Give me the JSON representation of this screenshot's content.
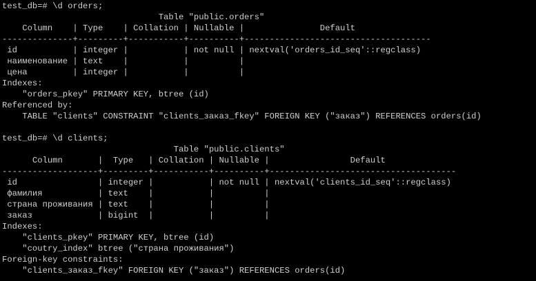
{
  "terminal": {
    "lines": [
      "test_db=# \\d orders;",
      "                               Table \"public.orders\"",
      "    Column    | Type    | Collation | Nullable |               Default",
      "--------------+---------+-----------+----------+-------------------------------------",
      " id           | integer |           | not null | nextval('orders_id_seq'::regclass)",
      " наименование | text    |           |          |",
      " цена         | integer |           |          |",
      "Indexes:",
      "    \"orders_pkey\" PRIMARY KEY, btree (id)",
      "Referenced by:",
      "    TABLE \"clients\" CONSTRAINT \"clients_заказ_fkey\" FOREIGN KEY (\"заказ\") REFERENCES orders(id)",
      "",
      "test_db=# \\d clients;",
      "                                  Table \"public.clients\"",
      "      Column       |  Type   | Collation | Nullable |                Default",
      "-------------------+---------+-----------+----------+-------------------------------------",
      " id                | integer |           | not null | nextval('clients_id_seq'::regclass)",
      " фамилия           | text    |           |          |",
      " страна проживания | text    |           |          |",
      " заказ             | bigint  |           |          |",
      "Indexes:",
      "    \"clients_pkey\" PRIMARY KEY, btree (id)",
      "    \"coutry_index\" btree (\"страна проживания\")",
      "Foreign-key constraints:",
      "    \"clients_заказ_fkey\" FOREIGN KEY (\"заказ\") REFERENCES orders(id)"
    ]
  }
}
